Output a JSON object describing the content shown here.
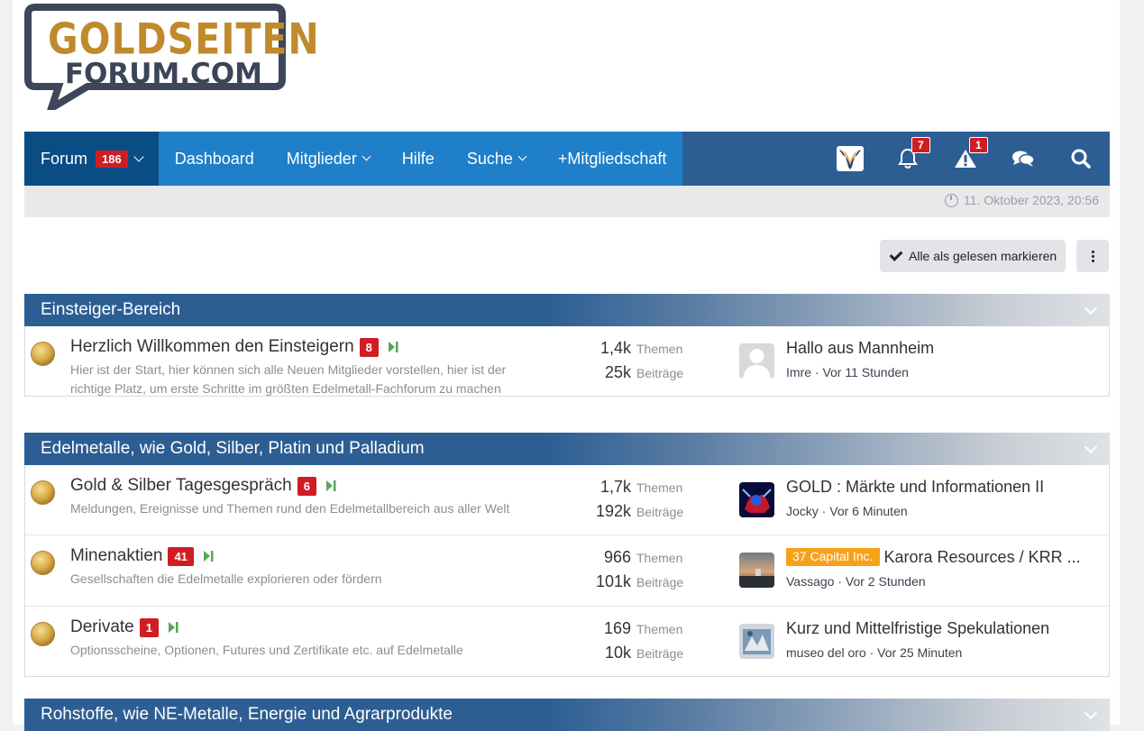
{
  "logo": {
    "line1": "GOLDSEITEN",
    "line2": "FORUM.COM"
  },
  "nav": {
    "tabs": [
      {
        "label": "Forum",
        "badge": "186",
        "dropdown": true,
        "active": true
      },
      {
        "label": "Dashboard",
        "dropdown": false
      },
      {
        "label": "Mitglieder",
        "dropdown": true
      },
      {
        "label": "Hilfe",
        "dropdown": false
      },
      {
        "label": "Suche",
        "dropdown": true
      },
      {
        "label": "+Mitgliedschaft",
        "dropdown": false
      }
    ],
    "icons": [
      {
        "name": "user-avatar-icon"
      },
      {
        "name": "bell-icon",
        "badge": "7"
      },
      {
        "name": "warning-icon",
        "badge": "1"
      },
      {
        "name": "conversations-icon"
      },
      {
        "name": "search-icon"
      }
    ]
  },
  "datetime": "11. Oktober 2023, 20:56",
  "actions": {
    "mark_read": "Alle als gelesen markieren"
  },
  "categories": [
    {
      "title": "Einsteiger-Bereich",
      "nodes": [
        {
          "title": "Herzlich Willkommen den Einsteigern",
          "badge": "8",
          "desc": "Hier ist der Start, hier können sich alle Neuen Mitglieder vorstellen, hier ist der richtige Platz, um erste Schritte im größten Edelmetall-Fachforum zu machen",
          "themen": "1,4k",
          "themen_label": "Themen",
          "beitraege": "25k",
          "beitraege_label": "Beiträge",
          "last_title": "Hallo aus Mannheim",
          "last_user": "Imre",
          "last_time": "Vor 11 Stunden",
          "avatar": "default"
        }
      ]
    },
    {
      "title": "Edelmetalle, wie Gold, Silber, Platin und Palladium",
      "nodes": [
        {
          "title": "Gold & Silber Tagesgespräch",
          "badge": "6",
          "desc": "Meldungen, Ereignisse und Themen rund den Edelmetallbereich aus aller Welt",
          "themen": "1,7k",
          "themen_label": "Themen",
          "beitraege": "192k",
          "beitraege_label": "Beiträge",
          "last_title": "GOLD : Märkte und Informationen II",
          "last_user": "Jocky",
          "last_time": "Vor 6 Minuten",
          "avatar": "jocky"
        },
        {
          "title": "Minenaktien",
          "badge": "41",
          "desc": "Gesellschaften die Edelmetalle explorieren oder fördern",
          "themen": "966",
          "themen_label": "Themen",
          "beitraege": "101k",
          "beitraege_label": "Beiträge",
          "last_prefix": "37 Capital Inc.",
          "last_title": "Karora Resources / KRR ...",
          "last_user": "Vassago",
          "last_time": "Vor 2 Stunden",
          "avatar": "vassago"
        },
        {
          "title": "Derivate",
          "badge": "1",
          "desc": "Optionsscheine, Optionen, Futures und Zertifikate etc. auf Edelmetalle",
          "themen": "169",
          "themen_label": "Themen",
          "beitraege": "10k",
          "beitraege_label": "Beiträge",
          "last_title": "Kurz und Mittelfristige Spekulationen",
          "last_user": "museo del oro",
          "last_time": "Vor 25 Minuten",
          "avatar": "museo"
        }
      ]
    },
    {
      "title": "Rohstoffe, wie NE-Metalle, Energie und Agrarprodukte",
      "nodes": []
    }
  ]
}
